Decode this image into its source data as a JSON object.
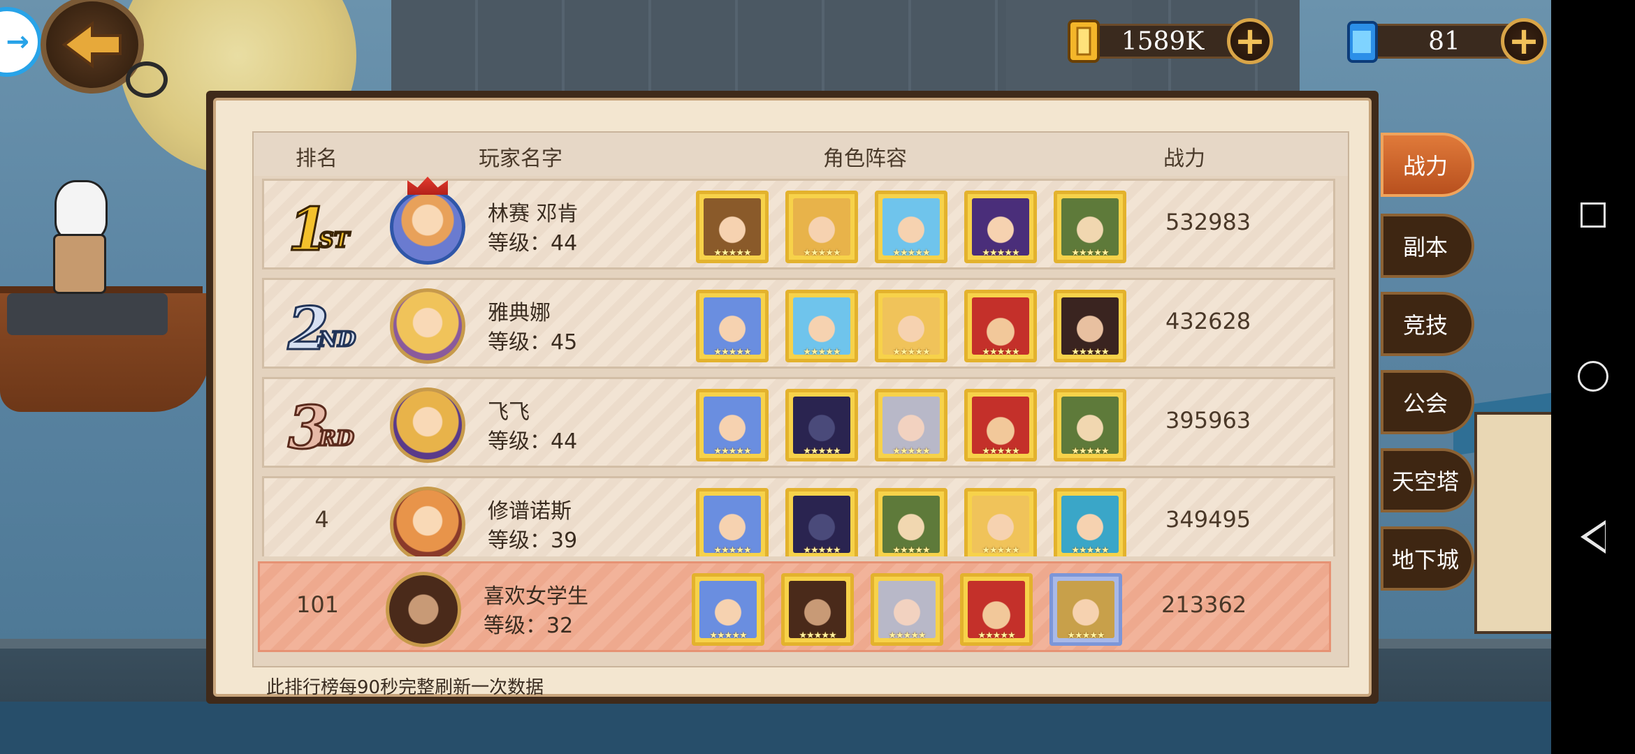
{
  "currency": {
    "gold": "1589K",
    "gems": "81"
  },
  "table": {
    "headers": {
      "rank": "排名",
      "player": "玩家名字",
      "lineup": "角色阵容",
      "power": "战力"
    },
    "rows": [
      {
        "rank": "1",
        "suffix": "ST",
        "name": "林赛 邓肯",
        "level": "等级：44",
        "power": "532983"
      },
      {
        "rank": "2",
        "suffix": "ND",
        "name": "雅典娜",
        "level": "等级：45",
        "power": "432628"
      },
      {
        "rank": "3",
        "suffix": "RD",
        "name": "飞飞",
        "level": "等级：44",
        "power": "395963"
      },
      {
        "rank": "4",
        "suffix": "",
        "name": "修谱诺斯",
        "level": "等级：39",
        "power": "349495"
      }
    ],
    "my_row": {
      "rank": "101",
      "name": "喜欢女学生",
      "level": "等级：32",
      "power": "213362"
    },
    "hero_stars": "★★★★★",
    "footer_note": "此排行榜每90秒完整刷新一次数据"
  },
  "tabs": [
    "战力",
    "副本",
    "竞技",
    "公会",
    "天空塔",
    "地下城"
  ],
  "active_tab": "战力",
  "colors": {
    "panel_bg": "#f3e6d0",
    "my_row": "#f2b39a",
    "active_tab": "#d4652c",
    "gold_frame": "#e3b22d"
  }
}
